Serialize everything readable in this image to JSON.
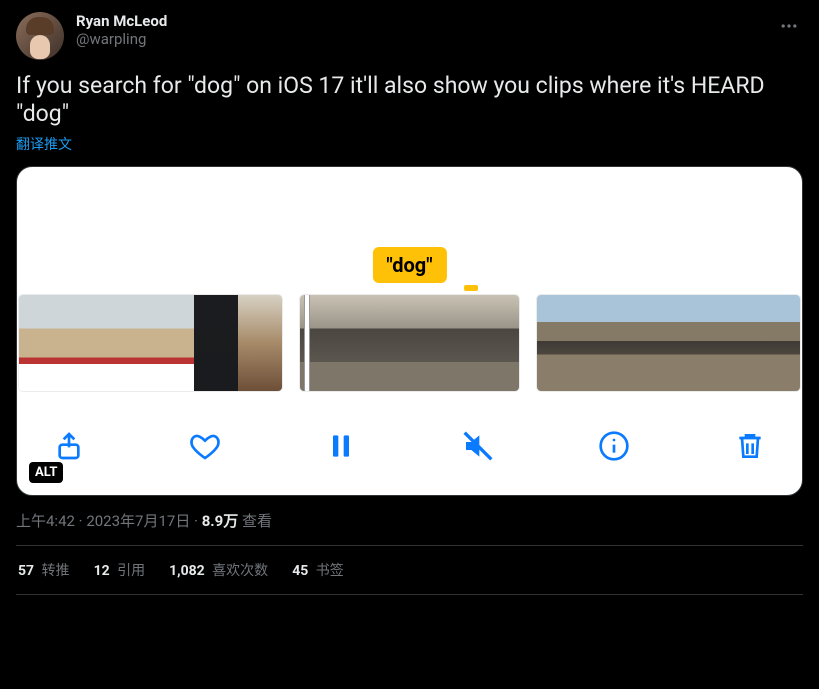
{
  "author": {
    "display_name": "Ryan McLeod",
    "handle": "@warpling"
  },
  "text": "If you search for \"dog\" on iOS 17 it'll also show you clips where it's HEARD \"dog\"",
  "translate_label": "翻译推文",
  "media": {
    "tooltip": "\"dog\"",
    "alt_badge": "ALT"
  },
  "meta": {
    "time": "上午4:42",
    "dot1": " · ",
    "date": "2023年7月17日",
    "dot2": " · ",
    "views_count": "8.9万",
    "views_label": " 查看"
  },
  "engagement": {
    "retweets": {
      "count": "57",
      "label": " 转推"
    },
    "quotes": {
      "count": "12",
      "label": " 引用"
    },
    "likes": {
      "count": "1,082",
      "label": " 喜欢次数"
    },
    "bookmarks": {
      "count": "45",
      "label": " 书签"
    }
  }
}
